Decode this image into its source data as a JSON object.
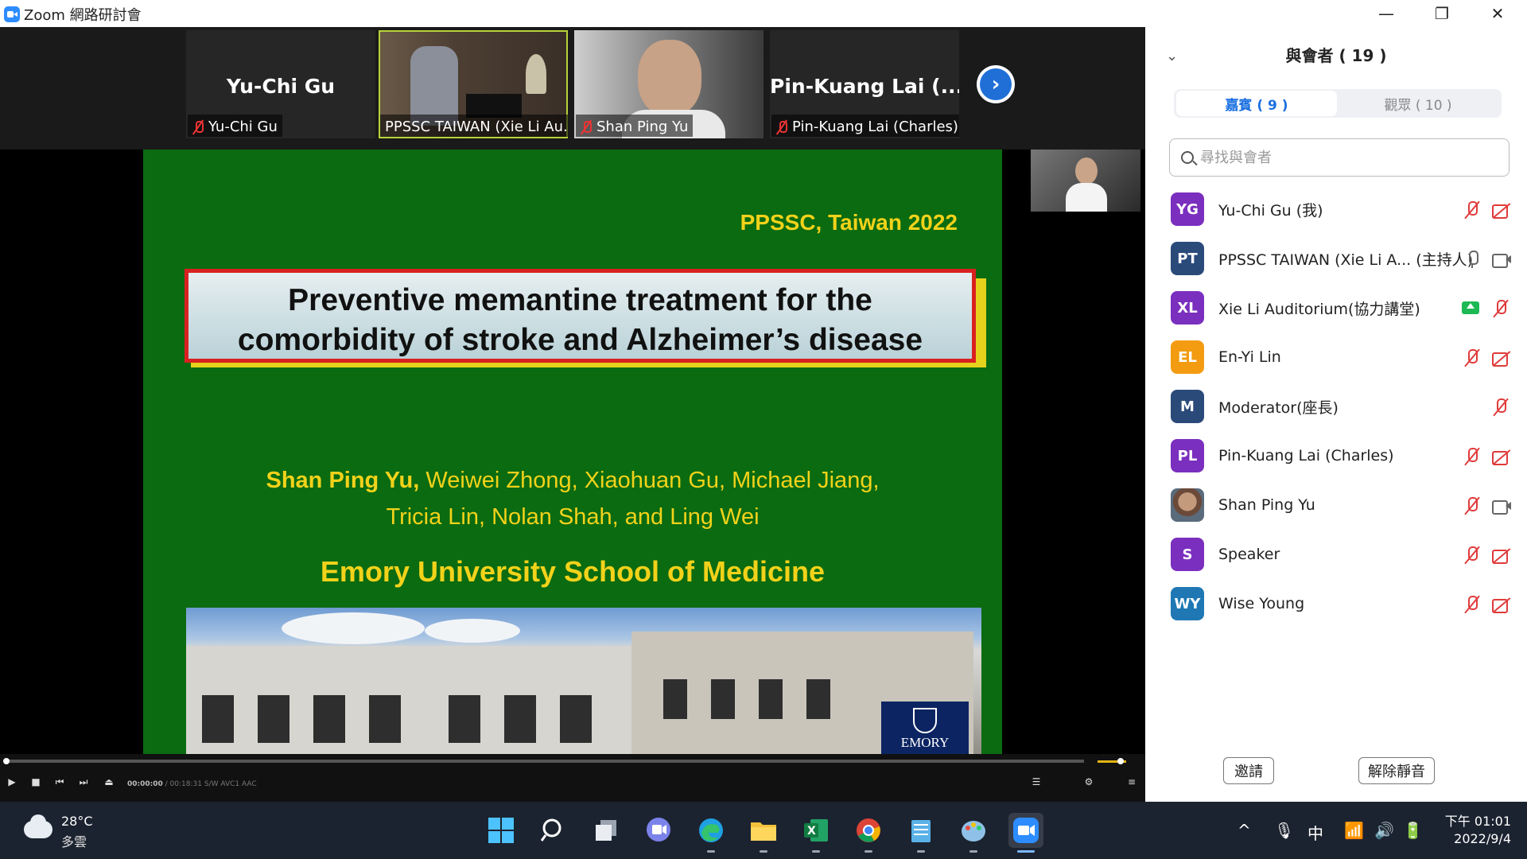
{
  "window": {
    "title": "Zoom 網路研討會",
    "minimize_glyph": "—",
    "restore_glyph": "❐",
    "close_glyph": "✕"
  },
  "video_strip": {
    "tiles": [
      {
        "big_name": "Yu-Chi Gu",
        "label": "Yu-Chi Gu",
        "muted": true
      },
      {
        "big_name": "",
        "label": "PPSSC TAIWAN (Xie Li Au...",
        "muted": false
      },
      {
        "big_name": "",
        "label": "Shan Ping Yu",
        "muted": true
      },
      {
        "big_name": "Pin-Kuang Lai (...",
        "label": "Pin-Kuang Lai (Charles)",
        "muted": true
      }
    ],
    "next_glyph": "›"
  },
  "slide": {
    "conference": "PPSSC, Taiwan 2022",
    "title_line1": "Preventive memantine treatment for the",
    "title_line2": "comorbidity of stroke and Alzheimer’s disease",
    "authors_bold": "Shan Ping Yu,",
    "authors_rest1": " Weiwei Zhong, Xiaohuan Gu, Michael Jiang,",
    "authors_line2": "Tricia Lin, Nolan Shah, and Ling Wei",
    "school": "Emory University School of Medicine",
    "emory_logo_text": "EMORY",
    "colors": {
      "background": "#0b6b10",
      "text": "#f2d21a",
      "title_border": "#d92020"
    }
  },
  "player": {
    "time_current": "00:00:00",
    "time_total": "/ 00:18:31",
    "tags": [
      "S/W",
      "AVC1",
      "AAC"
    ]
  },
  "participants": {
    "title": "與會者 ( 19 )",
    "tab_panelists": "嘉賓 ( 9 )",
    "tab_attendees": "觀眾 ( 10 )",
    "search_placeholder": "尋找與會者",
    "list": [
      {
        "initials": "YG",
        "name": "Yu-Chi Gu (我)",
        "color": "#7b2fbe",
        "mic": "muted",
        "cam": "off"
      },
      {
        "initials": "PT",
        "name": "PPSSC TAIWAN (Xie Li A... (主持人)",
        "color": "#2a4a7a",
        "mic": "on",
        "cam": "on"
      },
      {
        "initials": "XL",
        "name": "Xie Li Auditorium(協力講堂)",
        "color": "#7b2fbe",
        "mic": "muted",
        "cam": "share"
      },
      {
        "initials": "EL",
        "name": "En-Yi Lin",
        "color": "#f39c12",
        "mic": "muted",
        "cam": "off"
      },
      {
        "initials": "M",
        "name": "Moderator(座長)",
        "color": "#2a4a7a",
        "mic": "muted",
        "cam": "none"
      },
      {
        "initials": "PL",
        "name": "Pin-Kuang Lai (Charles)",
        "color": "#7b2fbe",
        "mic": "muted",
        "cam": "off"
      },
      {
        "initials": "",
        "name": "Shan Ping Yu",
        "color": "#555555",
        "mic": "muted",
        "cam": "on"
      },
      {
        "initials": "S",
        "name": "Speaker",
        "color": "#7b2fbe",
        "mic": "muted",
        "cam": "off"
      },
      {
        "initials": "WY",
        "name": "Wise Young",
        "color": "#1f78b4",
        "mic": "muted",
        "cam": "off"
      }
    ],
    "invite_button": "邀請",
    "unmute_button": "解除靜音"
  },
  "taskbar": {
    "weather_temp": "28°C",
    "weather_desc": "多雲",
    "ime": "中",
    "time": "下午 01:01",
    "date": "2022/9/4"
  }
}
